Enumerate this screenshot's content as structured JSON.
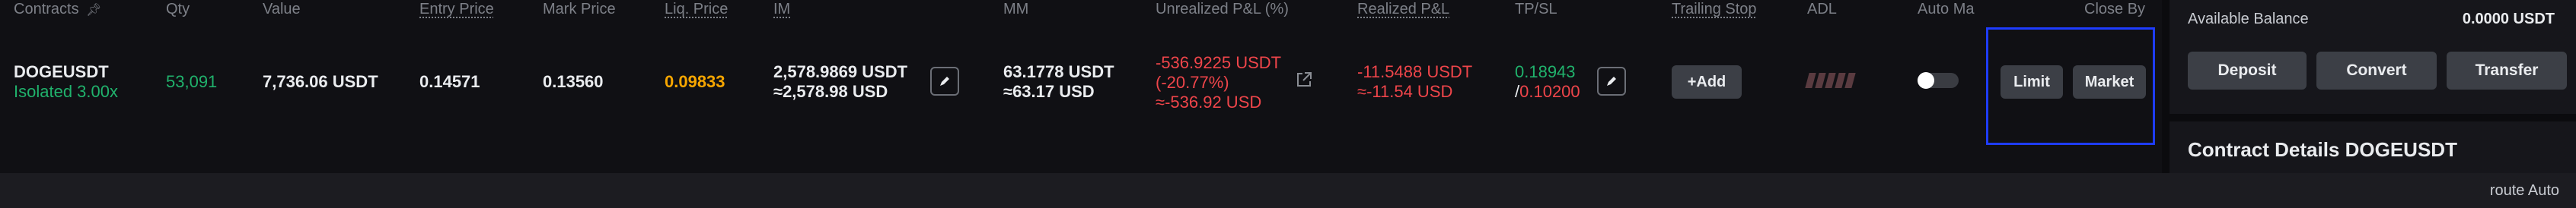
{
  "table": {
    "headers": {
      "contracts": "Contracts",
      "qty": "Qty",
      "value": "Value",
      "entry_price": "Entry Price",
      "mark_price": "Mark Price",
      "liq_price": "Liq. Price",
      "im": "IM",
      "mm": "MM",
      "unrealized_pnl": "Unrealized P&L (%)",
      "realized_pnl": "Realized P&L",
      "tp_sl": "TP/SL",
      "trailing_stop": "Trailing Stop",
      "adl": "ADL",
      "auto_margin": "Auto Ma",
      "close_by": "Close By"
    },
    "row": {
      "symbol": "DOGEUSDT",
      "margin_mode": "Isolated 3.00x",
      "qty": "53,091",
      "value": "7,736.06 USDT",
      "entry_price": "0.14571",
      "mark_price": "0.13560",
      "liq_price": "0.09833",
      "im_usdt": "2,578.9869 USDT",
      "im_usd": "≈2,578.98 USD",
      "mm_usdt": "63.1778 USDT",
      "mm_usd": "≈63.17 USD",
      "upnl_usdt": "-536.9225 USDT",
      "upnl_pct": "(-20.77%)",
      "upnl_usd": "≈-536.92 USD",
      "rpnl_usdt": "-11.5488 USDT",
      "rpnl_usd": "≈-11.54 USD",
      "tp": "0.18943",
      "sl_sep": "/",
      "sl": "0.10200",
      "add_label": "+Add",
      "limit_label": "Limit",
      "market_label": "Market",
      "adl_level": 0,
      "auto_margin_on": false
    }
  },
  "side_panel": {
    "available_balance_label": "Available Balance",
    "available_balance_value": "0.0000 USDT",
    "deposit_label": "Deposit",
    "convert_label": "Convert",
    "transfer_label": "Transfer",
    "contract_details_title": "Contract Details DOGEUSDT"
  },
  "footer": {
    "route_text": "route Auto"
  },
  "colors": {
    "background": "#101014",
    "profit": "#20b26c",
    "loss": "#ef454a",
    "liquidation": "#f7a600",
    "highlight_box": "#1e3cff"
  }
}
